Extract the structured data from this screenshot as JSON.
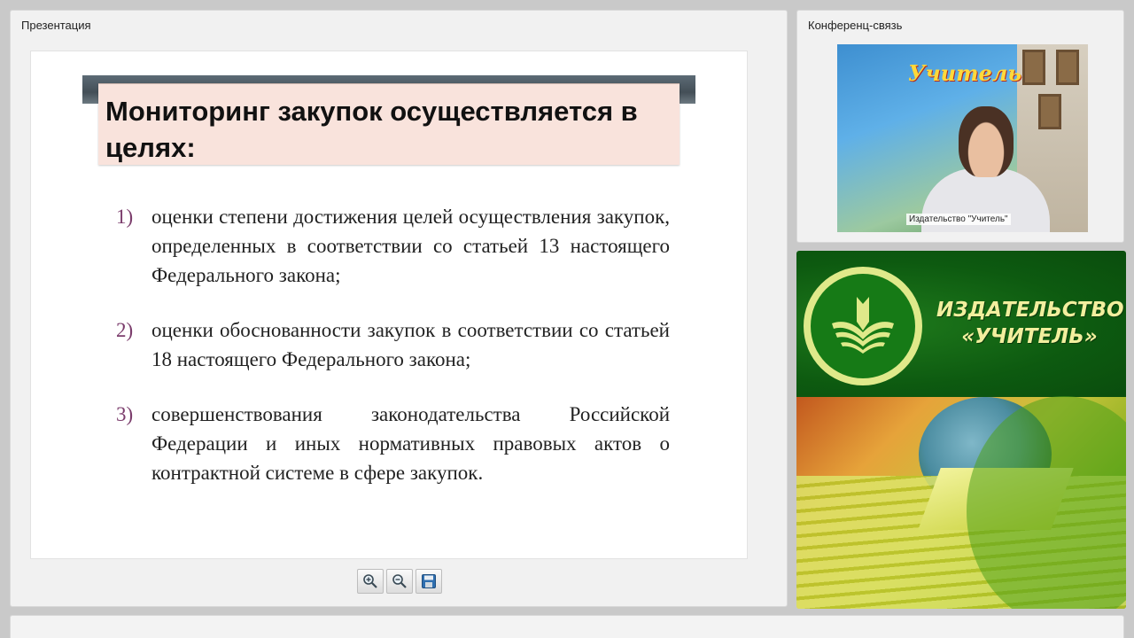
{
  "presentation": {
    "panel_title": "Презентация",
    "slide": {
      "title": "Мониторинг закупок осуществляется в целях:",
      "items": [
        {
          "num": "1)",
          "text": "оценки степени достижения целей осуществления закупок, определенных в соответствии со статьей 13 настоящего Федерального закона;"
        },
        {
          "num": "2)",
          "text": "оценки обоснованности закупок в соответствии со статьей 18 настоящего Федерального закона;"
        },
        {
          "num": "3)",
          "text": "совершенствования законодательства Российской Федерации и иных нормативных правовых актов о контрактной системе в сфере закупок."
        }
      ]
    },
    "toolbar": [
      {
        "name": "zoom-in",
        "icon": "zoom-in-icon"
      },
      {
        "name": "zoom-out",
        "icon": "zoom-out-icon"
      },
      {
        "name": "save",
        "icon": "save-icon"
      }
    ]
  },
  "conference": {
    "panel_title": "Конференц-связь",
    "participant_label": "Издательство \"Учитель\"",
    "background_banner_text": "Учитель"
  },
  "publisher_banner": {
    "line1": "ИЗДАТЕЛЬСТВО",
    "line2": "«УЧИТЕЛЬ»"
  },
  "colors": {
    "title_box_bg": "#f9e3dc",
    "item_number": "#7b3d6c",
    "banner_green": "#0d5a10",
    "banner_text": "#f2ef9e"
  }
}
